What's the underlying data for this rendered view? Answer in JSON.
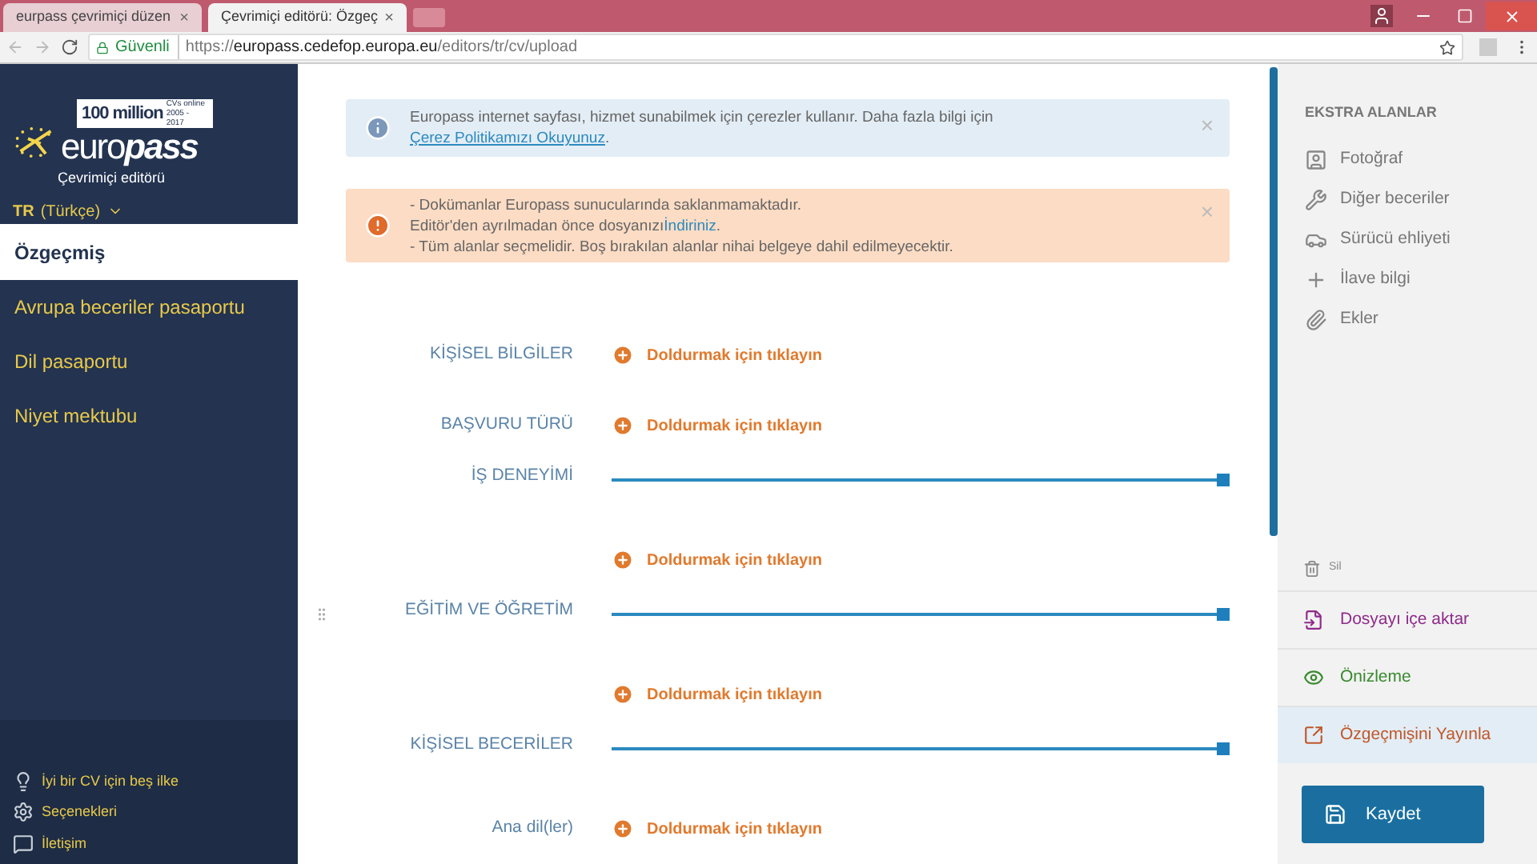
{
  "browser": {
    "tabs": [
      {
        "title": "eurpass çevrimiçi düzen",
        "close": "×",
        "selected": false
      },
      {
        "title": "Çevrimiçi editörü: Özgeç",
        "close": "×",
        "selected": true
      }
    ],
    "secure_label": "Güvenli",
    "url": {
      "scheme": "https://",
      "host": "europass.cedefop.europa.eu",
      "path": "/editors/tr/cv/upload"
    }
  },
  "sidebar": {
    "logo": {
      "badge": "100 million",
      "badge_sub": "CVs online 2005 - 2017",
      "word_light": "euro",
      "word_bold": "pass",
      "subtitle": "Çevrimiçi editörü"
    },
    "language": {
      "code": "TR",
      "name": "(Türkçe)"
    },
    "items": [
      {
        "label": "Özgeçmiş",
        "selected": true
      },
      {
        "label": "Avrupa beceriler pasaportu",
        "selected": false
      },
      {
        "label": "Dil pasaportu",
        "selected": false
      },
      {
        "label": "Niyet mektubu",
        "selected": false
      }
    ],
    "footer_links": [
      {
        "kind": "tips",
        "label": "İyi bir CV için beş ilke"
      },
      {
        "kind": "settings",
        "label": "Seçenekleri"
      },
      {
        "kind": "contact",
        "label": "İletişim"
      }
    ]
  },
  "alerts": [
    {
      "kind": "info",
      "text": "Europass internet sayfası, hizmet sunabilmek için çerezler kullanır. Daha fazla bilgi için ",
      "link": "Çerez Politikamızı Okuyunuz",
      "after": ".",
      "close": "×"
    },
    {
      "kind": "warning",
      "lines": [
        {
          "text": "- Dokümanlar Europass sunucularında saklanmamaktadır."
        },
        {
          "text": "Editör'den ayrılmadan önce dosyanızı",
          "link": "İndiriniz",
          "after": "."
        },
        {
          "text": "- Tüm alanlar seçmelidir. Boş bırakılan alanlar nihai belgeye dahil edilmeyecektir."
        }
      ],
      "close": "×"
    }
  ],
  "sections": [
    {
      "kind": "add",
      "label": "KİŞİSEL BİLGİLER",
      "action": "Doldurmak için tıklayın"
    },
    {
      "kind": "add",
      "label": "BAŞVURU TÜRÜ",
      "action": "Doldurmak için tıklayın"
    },
    {
      "kind": "rule",
      "label": "İŞ DENEYİMİ"
    },
    {
      "kind": "add",
      "action": "Doldurmak için tıklayın"
    },
    {
      "kind": "rule",
      "label": "EĞİTİM VE ÖĞRETİM"
    },
    {
      "kind": "add",
      "action": "Doldurmak için tıklayın"
    },
    {
      "kind": "rule",
      "label": "KİŞİSEL BECERİLER"
    },
    {
      "kind": "add",
      "label": "Ana dil(ler)",
      "action": "Doldurmak için tıklayın"
    }
  ],
  "extra_fields": {
    "title": "EKSTRA ALANLAR",
    "items": [
      {
        "kind": "photo",
        "label": "Fotoğraf"
      },
      {
        "kind": "skills",
        "label": "Diğer beceriler"
      },
      {
        "kind": "driving",
        "label": "Sürücü ehliyeti"
      },
      {
        "kind": "additional",
        "label": "İlave bilgi"
      },
      {
        "kind": "attachments",
        "label": "Ekler"
      }
    ]
  },
  "delete_label": "Sil",
  "actions": [
    {
      "kind": "import",
      "label": "Dosyayı içe aktar",
      "color": "#8e2a8b",
      "selected": false
    },
    {
      "kind": "preview",
      "label": "Önizleme",
      "color": "#3a8a2e",
      "selected": false
    },
    {
      "kind": "publish",
      "label": "Özgeçmişini Yayınla",
      "color": "#c0582a",
      "selected": true
    }
  ],
  "save_button": "Kaydet"
}
